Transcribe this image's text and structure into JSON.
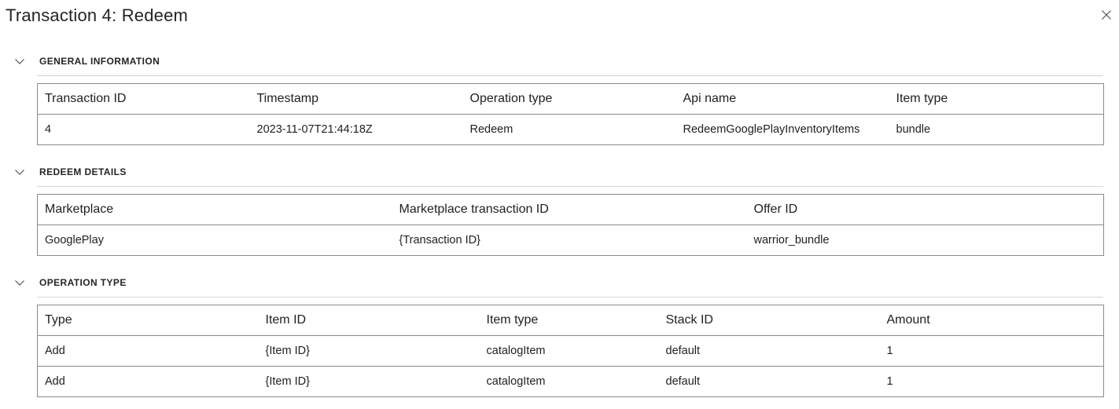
{
  "dialog": {
    "title": "Transaction 4: Redeem",
    "close_icon": "close-icon"
  },
  "general": {
    "title": "GENERAL INFORMATION",
    "headers": [
      "Transaction ID",
      "Timestamp",
      "Operation type",
      "Api name",
      "Item type"
    ],
    "rows": [
      [
        "4",
        "2023-11-07T21:44:18Z",
        "Redeem",
        "RedeemGooglePlayInventoryItems",
        "bundle"
      ]
    ]
  },
  "redeem": {
    "title": "REDEEM DETAILS",
    "headers": [
      "Marketplace",
      "Marketplace transaction ID",
      "Offer ID"
    ],
    "rows": [
      [
        "GooglePlay",
        "{Transaction ID}",
        "warrior_bundle"
      ]
    ]
  },
  "operation": {
    "title": "OPERATION TYPE",
    "headers": [
      "Type",
      "Item ID",
      "Item type",
      "Stack ID",
      "Amount"
    ],
    "rows": [
      [
        "Add",
        "{Item ID}",
        "catalogItem",
        "default",
        "1"
      ],
      [
        "Add",
        "{Item ID}",
        "catalogItem",
        "default",
        "1"
      ]
    ]
  }
}
